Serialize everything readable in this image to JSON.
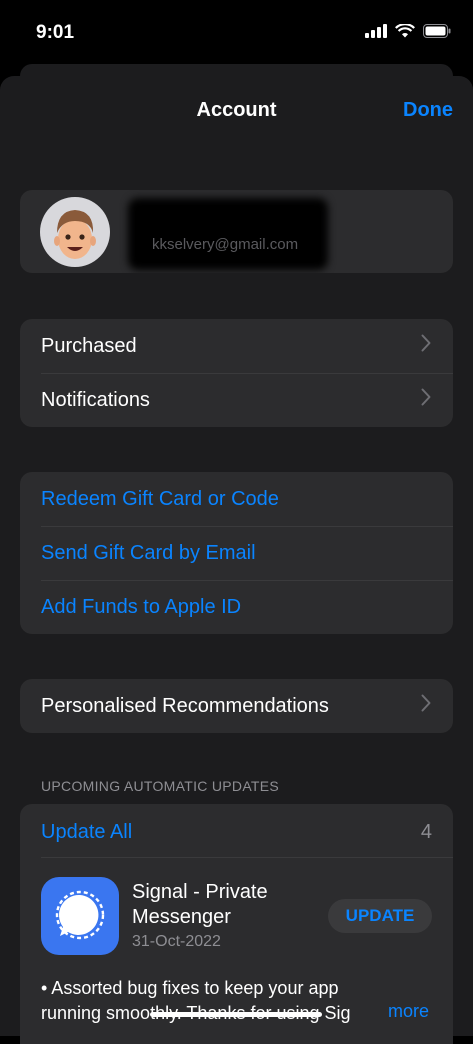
{
  "status_bar": {
    "time": "9:01"
  },
  "nav": {
    "title": "Account",
    "done_label": "Done"
  },
  "profile": {
    "email": "kkselvery@gmail.com"
  },
  "group1": {
    "items": [
      {
        "label": "Purchased"
      },
      {
        "label": "Notifications"
      }
    ]
  },
  "group2": {
    "items": [
      {
        "label": "Redeem Gift Card or Code"
      },
      {
        "label": "Send Gift Card by Email"
      },
      {
        "label": "Add Funds to Apple ID"
      }
    ]
  },
  "group3": {
    "items": [
      {
        "label": "Personalised Recommendations"
      }
    ]
  },
  "updates": {
    "section_header": "UPCOMING AUTOMATIC UPDATES",
    "update_all_label": "Update All",
    "count": "4",
    "app": {
      "name": "Signal - Private Messenger",
      "date": "31-Oct-2022",
      "button_label": "UPDATE",
      "notes": "• Assorted bug fixes to keep your app running smoothly. Thanks for using Sig",
      "more_label": "more"
    }
  },
  "colors": {
    "accent": "#0a84ff",
    "background": "#000000",
    "sheet": "#1c1c1e",
    "cell": "#2c2c2e"
  },
  "icons": [
    "cellular-signal-icon",
    "wifi-icon",
    "battery-icon",
    "chevron-right-icon",
    "memoji-avatar",
    "signal-app-icon"
  ]
}
